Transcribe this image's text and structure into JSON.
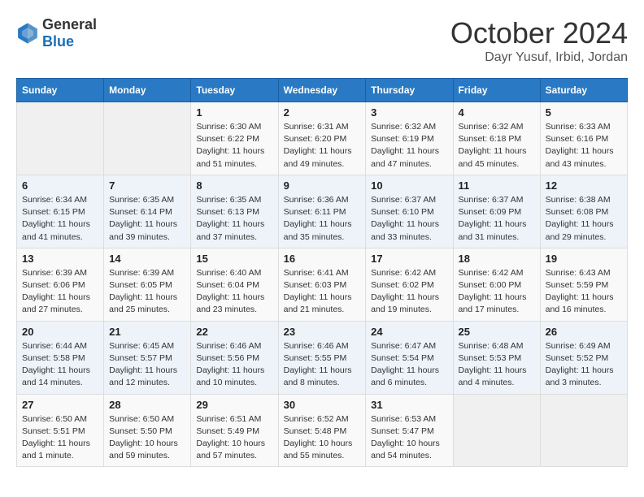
{
  "header": {
    "logo_general": "General",
    "logo_blue": "Blue",
    "month": "October 2024",
    "location": "Dayr Yusuf, Irbid, Jordan"
  },
  "weekdays": [
    "Sunday",
    "Monday",
    "Tuesday",
    "Wednesday",
    "Thursday",
    "Friday",
    "Saturday"
  ],
  "weeks": [
    [
      {
        "day": "",
        "info": ""
      },
      {
        "day": "",
        "info": ""
      },
      {
        "day": "1",
        "info": "Sunrise: 6:30 AM\nSunset: 6:22 PM\nDaylight: 11 hours and 51 minutes."
      },
      {
        "day": "2",
        "info": "Sunrise: 6:31 AM\nSunset: 6:20 PM\nDaylight: 11 hours and 49 minutes."
      },
      {
        "day": "3",
        "info": "Sunrise: 6:32 AM\nSunset: 6:19 PM\nDaylight: 11 hours and 47 minutes."
      },
      {
        "day": "4",
        "info": "Sunrise: 6:32 AM\nSunset: 6:18 PM\nDaylight: 11 hours and 45 minutes."
      },
      {
        "day": "5",
        "info": "Sunrise: 6:33 AM\nSunset: 6:16 PM\nDaylight: 11 hours and 43 minutes."
      }
    ],
    [
      {
        "day": "6",
        "info": "Sunrise: 6:34 AM\nSunset: 6:15 PM\nDaylight: 11 hours and 41 minutes."
      },
      {
        "day": "7",
        "info": "Sunrise: 6:35 AM\nSunset: 6:14 PM\nDaylight: 11 hours and 39 minutes."
      },
      {
        "day": "8",
        "info": "Sunrise: 6:35 AM\nSunset: 6:13 PM\nDaylight: 11 hours and 37 minutes."
      },
      {
        "day": "9",
        "info": "Sunrise: 6:36 AM\nSunset: 6:11 PM\nDaylight: 11 hours and 35 minutes."
      },
      {
        "day": "10",
        "info": "Sunrise: 6:37 AM\nSunset: 6:10 PM\nDaylight: 11 hours and 33 minutes."
      },
      {
        "day": "11",
        "info": "Sunrise: 6:37 AM\nSunset: 6:09 PM\nDaylight: 11 hours and 31 minutes."
      },
      {
        "day": "12",
        "info": "Sunrise: 6:38 AM\nSunset: 6:08 PM\nDaylight: 11 hours and 29 minutes."
      }
    ],
    [
      {
        "day": "13",
        "info": "Sunrise: 6:39 AM\nSunset: 6:06 PM\nDaylight: 11 hours and 27 minutes."
      },
      {
        "day": "14",
        "info": "Sunrise: 6:39 AM\nSunset: 6:05 PM\nDaylight: 11 hours and 25 minutes."
      },
      {
        "day": "15",
        "info": "Sunrise: 6:40 AM\nSunset: 6:04 PM\nDaylight: 11 hours and 23 minutes."
      },
      {
        "day": "16",
        "info": "Sunrise: 6:41 AM\nSunset: 6:03 PM\nDaylight: 11 hours and 21 minutes."
      },
      {
        "day": "17",
        "info": "Sunrise: 6:42 AM\nSunset: 6:02 PM\nDaylight: 11 hours and 19 minutes."
      },
      {
        "day": "18",
        "info": "Sunrise: 6:42 AM\nSunset: 6:00 PM\nDaylight: 11 hours and 17 minutes."
      },
      {
        "day": "19",
        "info": "Sunrise: 6:43 AM\nSunset: 5:59 PM\nDaylight: 11 hours and 16 minutes."
      }
    ],
    [
      {
        "day": "20",
        "info": "Sunrise: 6:44 AM\nSunset: 5:58 PM\nDaylight: 11 hours and 14 minutes."
      },
      {
        "day": "21",
        "info": "Sunrise: 6:45 AM\nSunset: 5:57 PM\nDaylight: 11 hours and 12 minutes."
      },
      {
        "day": "22",
        "info": "Sunrise: 6:46 AM\nSunset: 5:56 PM\nDaylight: 11 hours and 10 minutes."
      },
      {
        "day": "23",
        "info": "Sunrise: 6:46 AM\nSunset: 5:55 PM\nDaylight: 11 hours and 8 minutes."
      },
      {
        "day": "24",
        "info": "Sunrise: 6:47 AM\nSunset: 5:54 PM\nDaylight: 11 hours and 6 minutes."
      },
      {
        "day": "25",
        "info": "Sunrise: 6:48 AM\nSunset: 5:53 PM\nDaylight: 11 hours and 4 minutes."
      },
      {
        "day": "26",
        "info": "Sunrise: 6:49 AM\nSunset: 5:52 PM\nDaylight: 11 hours and 3 minutes."
      }
    ],
    [
      {
        "day": "27",
        "info": "Sunrise: 6:50 AM\nSunset: 5:51 PM\nDaylight: 11 hours and 1 minute."
      },
      {
        "day": "28",
        "info": "Sunrise: 6:50 AM\nSunset: 5:50 PM\nDaylight: 10 hours and 59 minutes."
      },
      {
        "day": "29",
        "info": "Sunrise: 6:51 AM\nSunset: 5:49 PM\nDaylight: 10 hours and 57 minutes."
      },
      {
        "day": "30",
        "info": "Sunrise: 6:52 AM\nSunset: 5:48 PM\nDaylight: 10 hours and 55 minutes."
      },
      {
        "day": "31",
        "info": "Sunrise: 6:53 AM\nSunset: 5:47 PM\nDaylight: 10 hours and 54 minutes."
      },
      {
        "day": "",
        "info": ""
      },
      {
        "day": "",
        "info": ""
      }
    ]
  ]
}
